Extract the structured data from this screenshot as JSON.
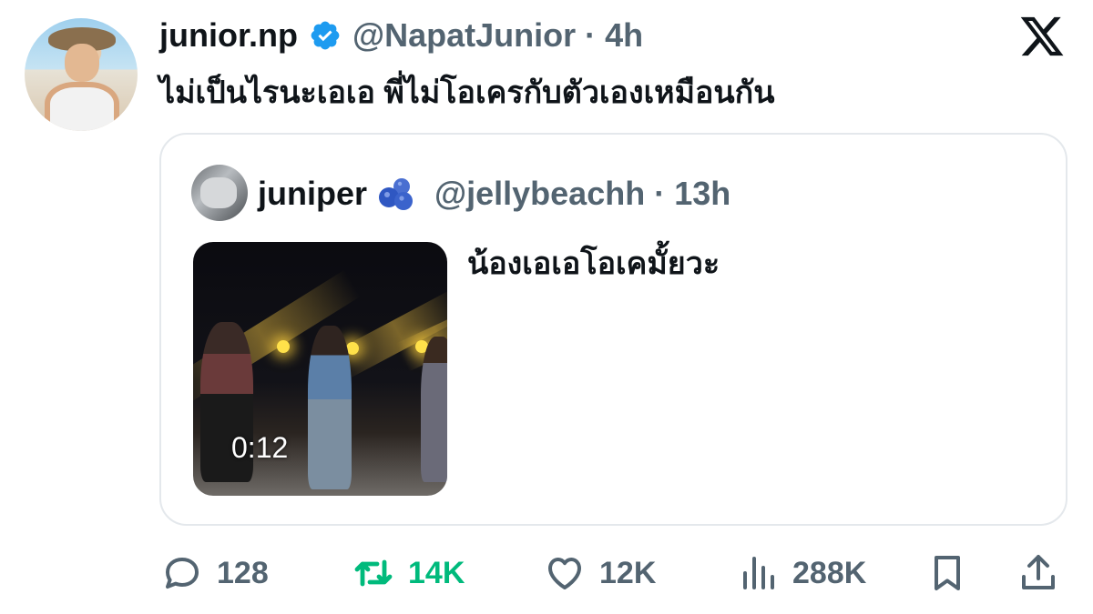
{
  "tweet": {
    "display_name": "junior.np",
    "handle": "@NapatJunior",
    "separator": "·",
    "time": "4h",
    "text": "ไม่เป็นไรนะเอเอ พี่ไม่โอเครกับตัวเองเหมือนกัน",
    "verified": true
  },
  "quoted": {
    "display_name": "juniper",
    "handle": "@jellybeachh",
    "separator": "·",
    "time": "13h",
    "text": "น้องเอเอโอเคมั้ยวะ",
    "media_duration": "0:12"
  },
  "actions": {
    "replies": "128",
    "retweets": "14K",
    "likes": "12K",
    "views": "288K"
  },
  "icons": {
    "verified": "verified-badge-icon",
    "x_logo": "x-logo-icon",
    "reply": "reply-icon",
    "retweet": "retweet-icon",
    "like": "heart-icon",
    "views": "views-icon",
    "bookmark": "bookmark-icon",
    "share": "share-icon"
  },
  "colors": {
    "verified": "#1d9bf0",
    "retweet_active": "#00ba7c",
    "secondary_text": "#536471",
    "primary_text": "#0f1419",
    "border": "#e4e8ec"
  }
}
